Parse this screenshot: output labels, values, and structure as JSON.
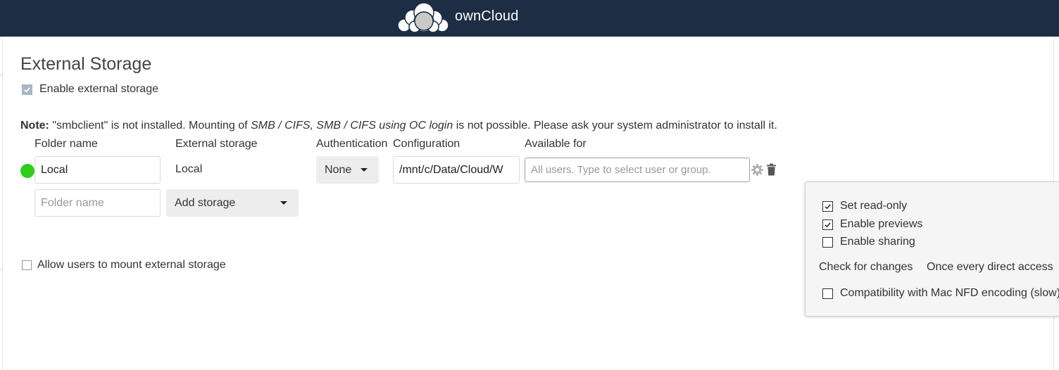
{
  "header": {
    "brand": "ownCloud",
    "logo_icon": "owncloud-cloud-logo",
    "background": "#1d2d44"
  },
  "section": {
    "title": "External Storage",
    "enable_external_storage": {
      "label": "Enable external storage",
      "checked": true
    }
  },
  "note": {
    "prefix": "Note:",
    "text_1": " \"smbclient\" is not installed. Mounting of ",
    "italic": "SMB / CIFS, SMB / CIFS using OC login",
    "text_2": " is not possible. Please ask your system administrator to install it."
  },
  "table": {
    "headers": {
      "folder_name": "Folder name",
      "external_storage": "External storage",
      "authentication": "Authentication",
      "configuration": "Configuration",
      "available_for": "Available for"
    },
    "row": {
      "status_color": "#2fcc1b",
      "folder_name": "Local",
      "external_storage": "Local",
      "authentication": "None",
      "configuration": "/mnt/c/Data/Cloud/W",
      "available_for_placeholder": "All users. Type to select user or group.",
      "settings_icon": "gear-icon",
      "delete_icon": "trash-icon"
    },
    "new_row": {
      "folder_name_placeholder": "Folder name",
      "add_storage": "Add storage"
    }
  },
  "allow_users_mount": {
    "label": "Allow users to mount external storage",
    "checked": false
  },
  "options_popover": {
    "set_read_only": {
      "label": "Set read-only",
      "checked": true
    },
    "enable_previews": {
      "label": "Enable previews",
      "checked": true
    },
    "enable_sharing": {
      "label": "Enable sharing",
      "checked": false
    },
    "check_for_changes": {
      "label": "Check for changes",
      "value": "Once every direct access"
    },
    "mac_nfd": {
      "label": "Compatibility with Mac NFD encoding (slow)",
      "checked": false
    }
  }
}
